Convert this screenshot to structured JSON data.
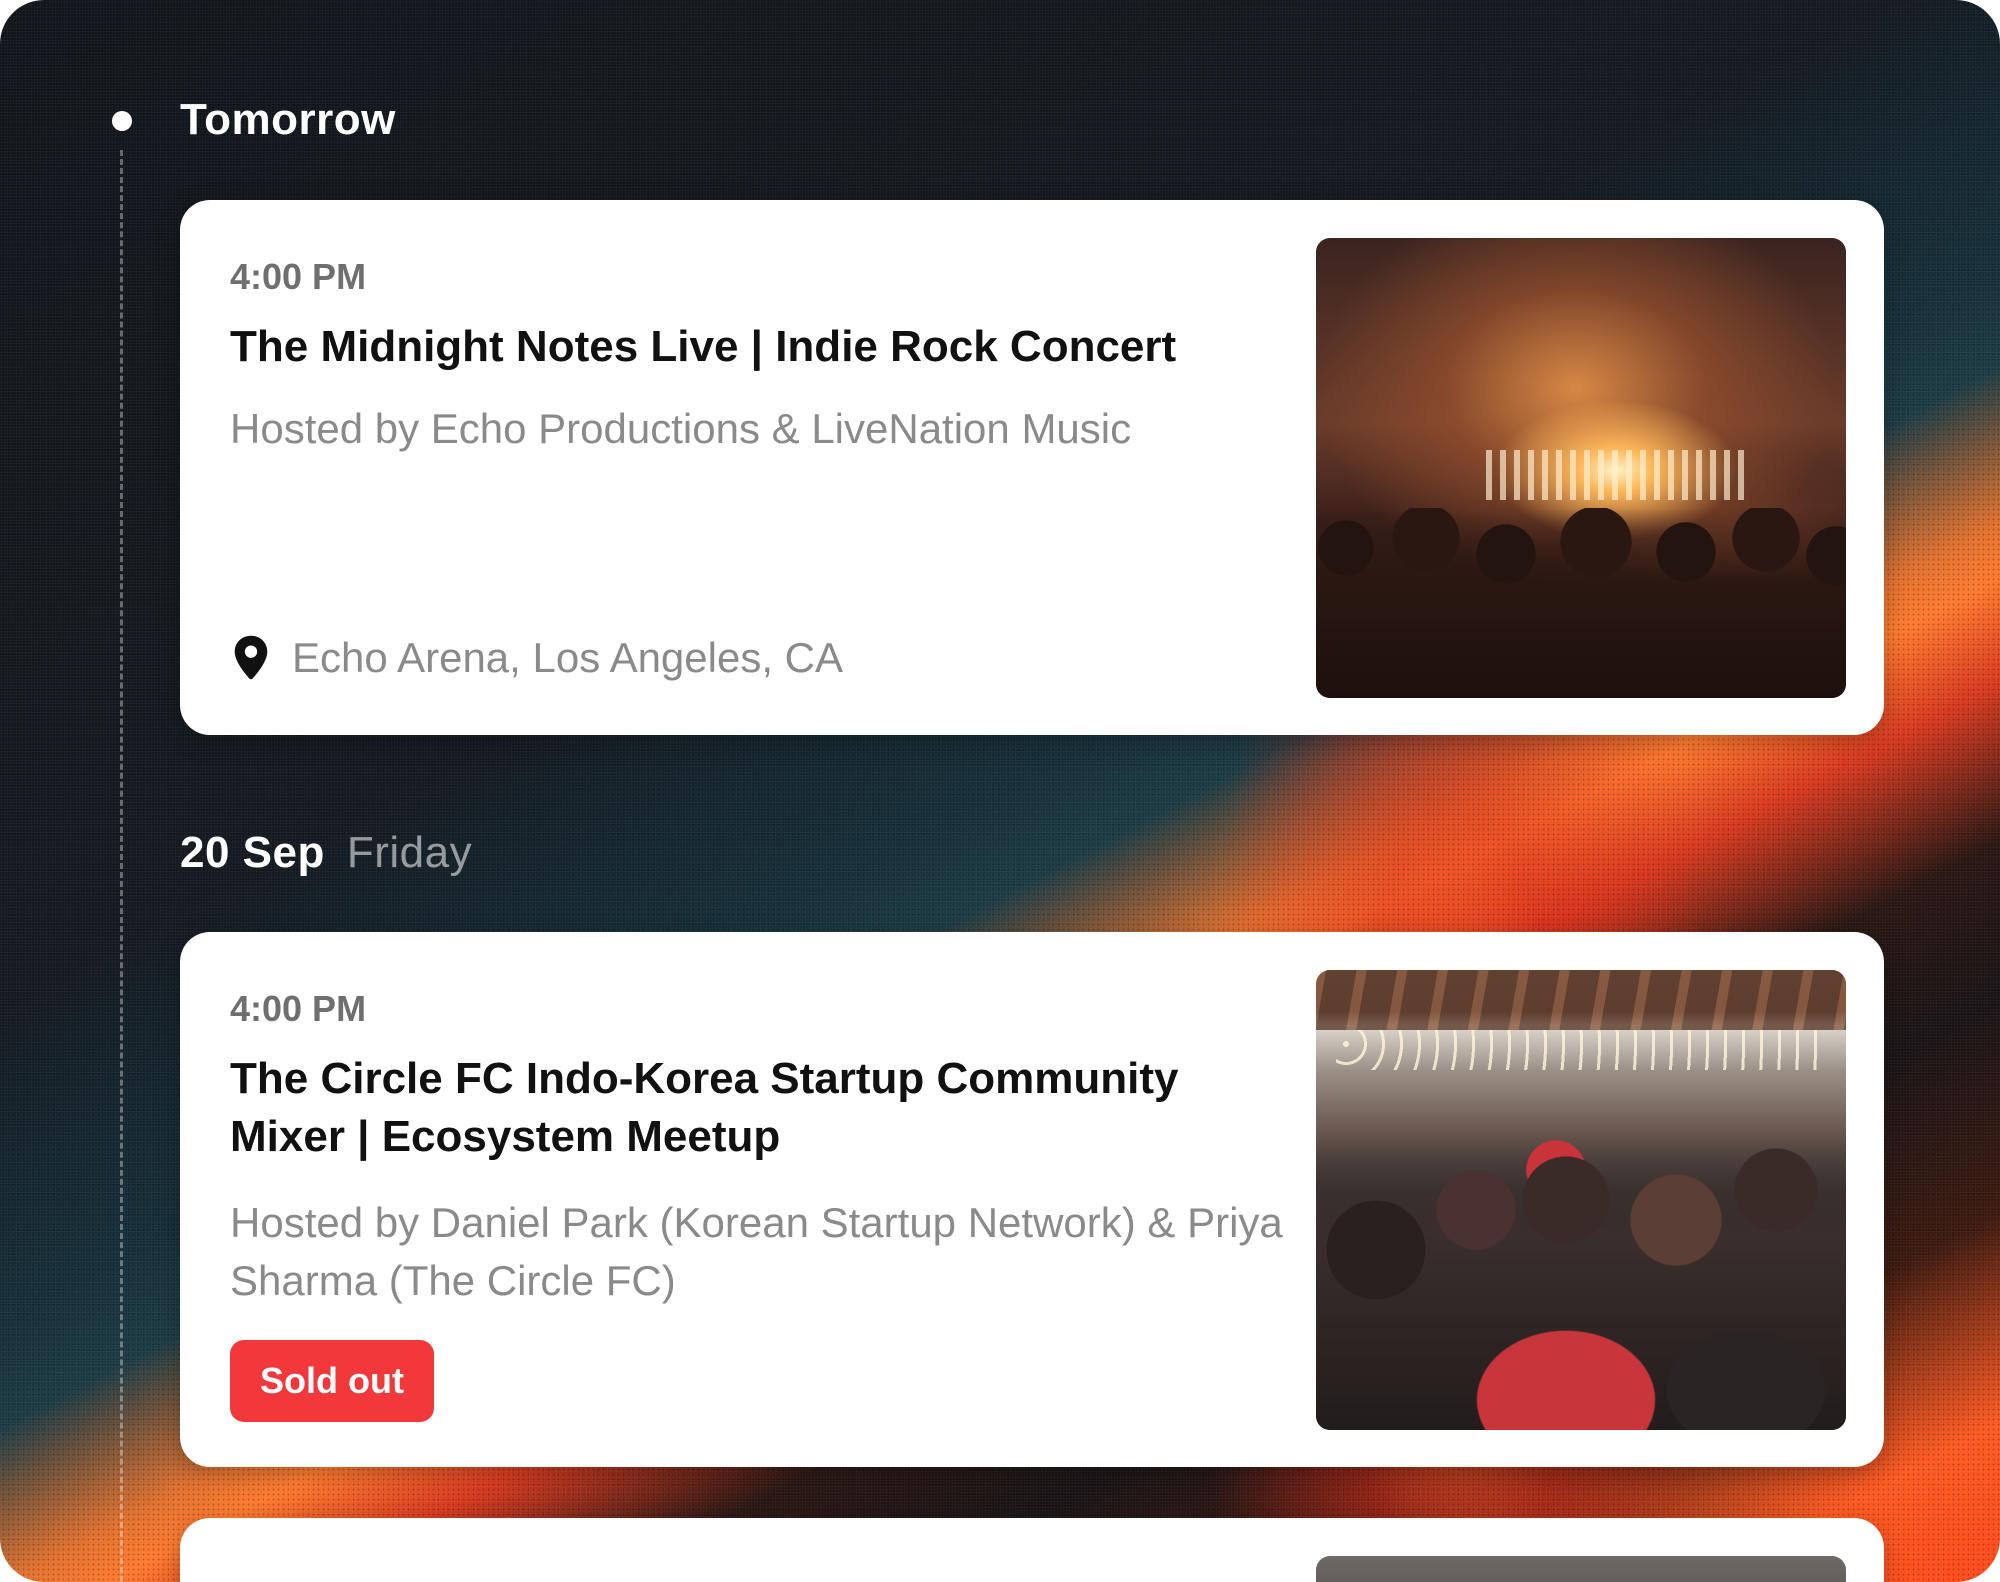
{
  "timeline": [
    {
      "day": "Tomorrow",
      "weekday": "",
      "events": [
        {
          "time": "4:00 PM",
          "title": "The Midnight Notes Live | Indie Rock Concert",
          "host": "Hosted by Echo Productions & LiveNation Music",
          "location": "Echo Arena, Los Angeles, CA",
          "icon": "location-pin-icon"
        }
      ]
    },
    {
      "day": "20 Sep",
      "weekday": "Friday",
      "events": [
        {
          "time": "4:00 PM",
          "title": "The Circle FC Indo-Korea Startup Community Mixer | Ecosystem Meetup",
          "host": "Hosted by Daniel Park (Korean Startup Network) & Priya Sharma (The Circle FC)",
          "badge": "Sold out",
          "badge_color": "#f2383a"
        }
      ]
    }
  ],
  "colors": {
    "background_dark": "#12161c",
    "accent_orange": "#ff7a2e",
    "text_primary": "#111111",
    "text_secondary": "#8a8a8a"
  }
}
